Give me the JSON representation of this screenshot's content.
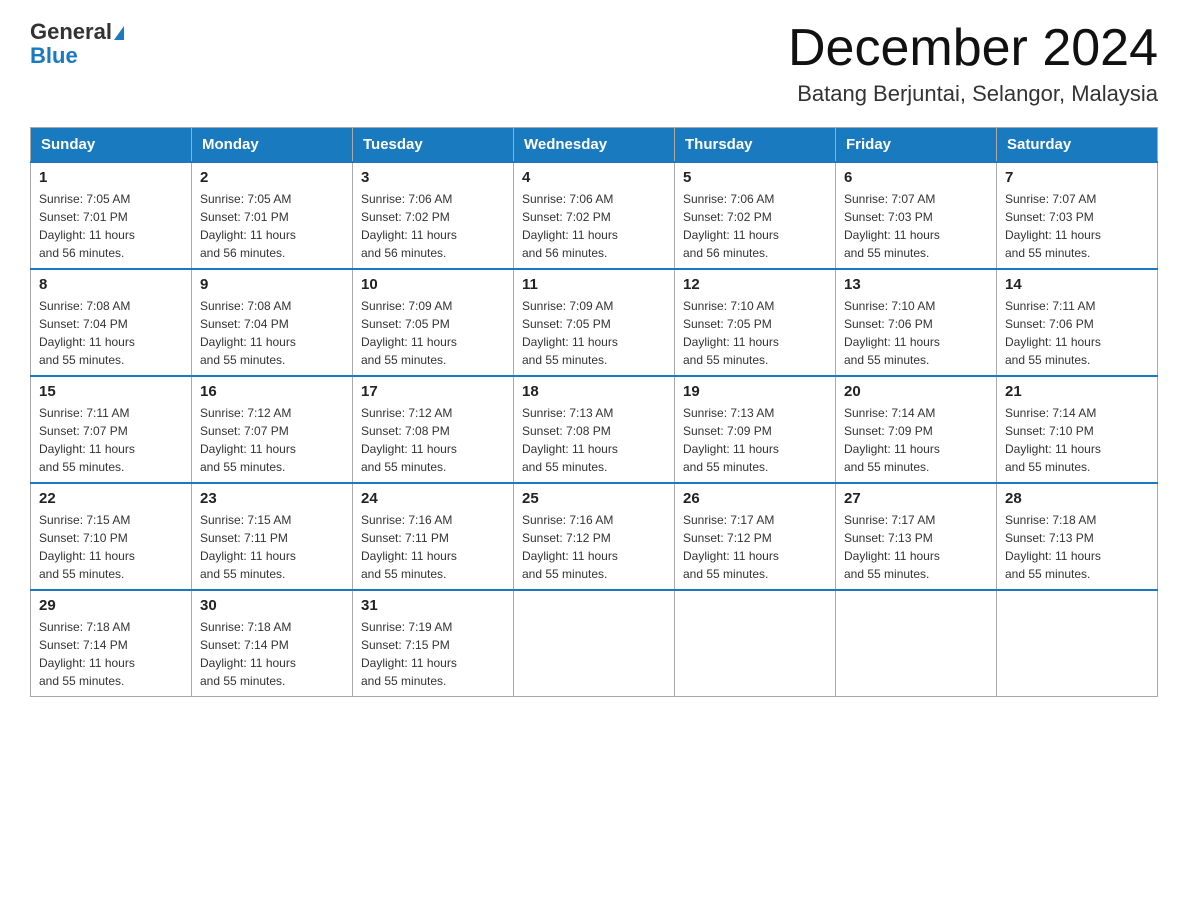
{
  "header": {
    "logo_general": "General",
    "logo_blue": "Blue",
    "month_title": "December 2024",
    "location": "Batang Berjuntai, Selangor, Malaysia"
  },
  "days_of_week": [
    "Sunday",
    "Monday",
    "Tuesday",
    "Wednesday",
    "Thursday",
    "Friday",
    "Saturday"
  ],
  "weeks": [
    [
      {
        "day": "1",
        "sunrise": "7:05 AM",
        "sunset": "7:01 PM",
        "daylight": "11 hours and 56 minutes."
      },
      {
        "day": "2",
        "sunrise": "7:05 AM",
        "sunset": "7:01 PM",
        "daylight": "11 hours and 56 minutes."
      },
      {
        "day": "3",
        "sunrise": "7:06 AM",
        "sunset": "7:02 PM",
        "daylight": "11 hours and 56 minutes."
      },
      {
        "day": "4",
        "sunrise": "7:06 AM",
        "sunset": "7:02 PM",
        "daylight": "11 hours and 56 minutes."
      },
      {
        "day": "5",
        "sunrise": "7:06 AM",
        "sunset": "7:02 PM",
        "daylight": "11 hours and 56 minutes."
      },
      {
        "day": "6",
        "sunrise": "7:07 AM",
        "sunset": "7:03 PM",
        "daylight": "11 hours and 55 minutes."
      },
      {
        "day": "7",
        "sunrise": "7:07 AM",
        "sunset": "7:03 PM",
        "daylight": "11 hours and 55 minutes."
      }
    ],
    [
      {
        "day": "8",
        "sunrise": "7:08 AM",
        "sunset": "7:04 PM",
        "daylight": "11 hours and 55 minutes."
      },
      {
        "day": "9",
        "sunrise": "7:08 AM",
        "sunset": "7:04 PM",
        "daylight": "11 hours and 55 minutes."
      },
      {
        "day": "10",
        "sunrise": "7:09 AM",
        "sunset": "7:05 PM",
        "daylight": "11 hours and 55 minutes."
      },
      {
        "day": "11",
        "sunrise": "7:09 AM",
        "sunset": "7:05 PM",
        "daylight": "11 hours and 55 minutes."
      },
      {
        "day": "12",
        "sunrise": "7:10 AM",
        "sunset": "7:05 PM",
        "daylight": "11 hours and 55 minutes."
      },
      {
        "day": "13",
        "sunrise": "7:10 AM",
        "sunset": "7:06 PM",
        "daylight": "11 hours and 55 minutes."
      },
      {
        "day": "14",
        "sunrise": "7:11 AM",
        "sunset": "7:06 PM",
        "daylight": "11 hours and 55 minutes."
      }
    ],
    [
      {
        "day": "15",
        "sunrise": "7:11 AM",
        "sunset": "7:07 PM",
        "daylight": "11 hours and 55 minutes."
      },
      {
        "day": "16",
        "sunrise": "7:12 AM",
        "sunset": "7:07 PM",
        "daylight": "11 hours and 55 minutes."
      },
      {
        "day": "17",
        "sunrise": "7:12 AM",
        "sunset": "7:08 PM",
        "daylight": "11 hours and 55 minutes."
      },
      {
        "day": "18",
        "sunrise": "7:13 AM",
        "sunset": "7:08 PM",
        "daylight": "11 hours and 55 minutes."
      },
      {
        "day": "19",
        "sunrise": "7:13 AM",
        "sunset": "7:09 PM",
        "daylight": "11 hours and 55 minutes."
      },
      {
        "day": "20",
        "sunrise": "7:14 AM",
        "sunset": "7:09 PM",
        "daylight": "11 hours and 55 minutes."
      },
      {
        "day": "21",
        "sunrise": "7:14 AM",
        "sunset": "7:10 PM",
        "daylight": "11 hours and 55 minutes."
      }
    ],
    [
      {
        "day": "22",
        "sunrise": "7:15 AM",
        "sunset": "7:10 PM",
        "daylight": "11 hours and 55 minutes."
      },
      {
        "day": "23",
        "sunrise": "7:15 AM",
        "sunset": "7:11 PM",
        "daylight": "11 hours and 55 minutes."
      },
      {
        "day": "24",
        "sunrise": "7:16 AM",
        "sunset": "7:11 PM",
        "daylight": "11 hours and 55 minutes."
      },
      {
        "day": "25",
        "sunrise": "7:16 AM",
        "sunset": "7:12 PM",
        "daylight": "11 hours and 55 minutes."
      },
      {
        "day": "26",
        "sunrise": "7:17 AM",
        "sunset": "7:12 PM",
        "daylight": "11 hours and 55 minutes."
      },
      {
        "day": "27",
        "sunrise": "7:17 AM",
        "sunset": "7:13 PM",
        "daylight": "11 hours and 55 minutes."
      },
      {
        "day": "28",
        "sunrise": "7:18 AM",
        "sunset": "7:13 PM",
        "daylight": "11 hours and 55 minutes."
      }
    ],
    [
      {
        "day": "29",
        "sunrise": "7:18 AM",
        "sunset": "7:14 PM",
        "daylight": "11 hours and 55 minutes."
      },
      {
        "day": "30",
        "sunrise": "7:18 AM",
        "sunset": "7:14 PM",
        "daylight": "11 hours and 55 minutes."
      },
      {
        "day": "31",
        "sunrise": "7:19 AM",
        "sunset": "7:15 PM",
        "daylight": "11 hours and 55 minutes."
      },
      null,
      null,
      null,
      null
    ]
  ],
  "labels": {
    "sunrise_prefix": "Sunrise: ",
    "sunset_prefix": "Sunset: ",
    "daylight_prefix": "Daylight: "
  }
}
